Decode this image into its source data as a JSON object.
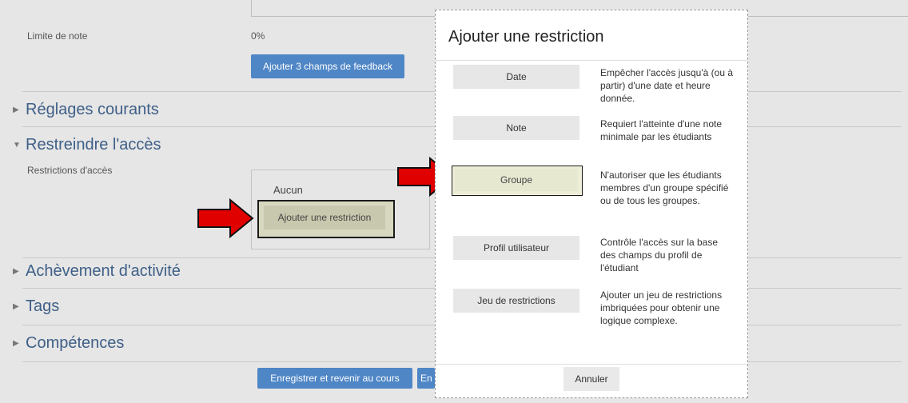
{
  "form": {
    "grade_limit_label": "Limite de note",
    "grade_limit_value": "0%",
    "add_feedback_label": "Ajouter 3 champs de feedback",
    "access_restrictions_label": "Restrictions d'accès",
    "none_label": "Aucun",
    "add_restriction_label": "Ajouter une restriction",
    "save_return_label": "Enregistrer et revenir au cours",
    "save_display_partial": "En"
  },
  "sections": [
    {
      "title": "Réglages courants",
      "expanded": false
    },
    {
      "title": "Restreindre l'accès",
      "expanded": true
    },
    {
      "title": "Achèvement d'activité",
      "expanded": false
    },
    {
      "title": "Tags",
      "expanded": false
    },
    {
      "title": "Compétences",
      "expanded": false
    }
  ],
  "modal": {
    "title": "Ajouter une restriction",
    "options": [
      {
        "button": "Date",
        "description": "Empêcher l'accès jusqu'à (ou à partir) d'une date et heure donnée."
      },
      {
        "button": "Note",
        "description": "Requiert l'atteinte d'une note minimale par les étudiants"
      },
      {
        "button": "Groupe",
        "description": "N'autoriser que les étudiants membres d'un groupe spécifié ou de tous les groupes."
      },
      {
        "button": "Profil utilisateur",
        "description": "Contrôle l'accès sur la base des champs du profil de l'étudiant"
      },
      {
        "button": "Jeu de restrictions",
        "description": "Ajouter un jeu de restrictions imbriquées pour obtenir une logique complexe."
      }
    ],
    "cancel_label": "Annuler"
  },
  "colors": {
    "primary_button": "#4f86c6",
    "section_title": "#3e5f87",
    "annotation_arrow": "#e00000"
  },
  "icons": {
    "collapsed_caret": "caret-right-icon",
    "expanded_caret": "caret-down-icon",
    "annotation": "red-arrow-icon"
  }
}
